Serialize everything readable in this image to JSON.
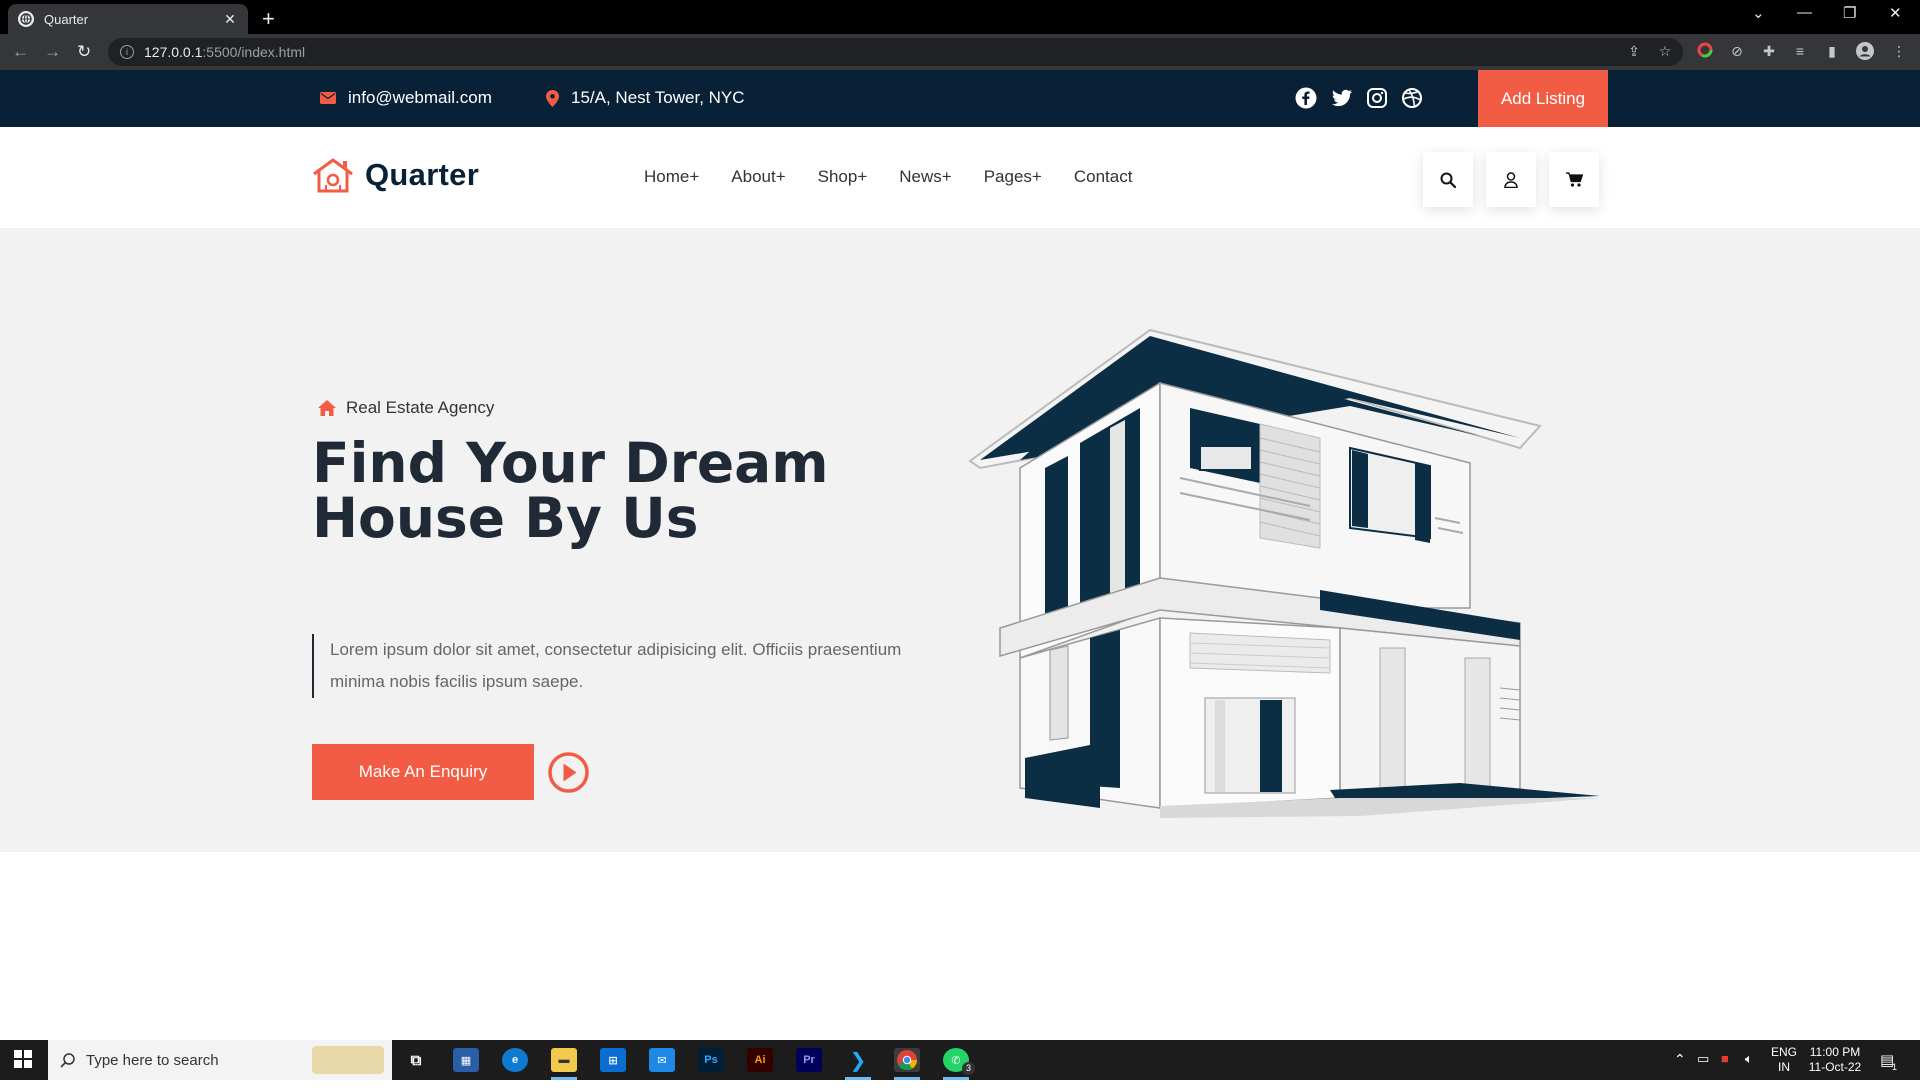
{
  "browser": {
    "tab_title": "Quarter",
    "new_tab": "+",
    "url_host": "127.0.0.1",
    "url_path": ":5500/index.html"
  },
  "topbar": {
    "email": "info@webmail.com",
    "address": "15/A, Nest Tower, NYC",
    "add_listing": "Add Listing"
  },
  "header": {
    "logo_text": "Quarter",
    "nav": [
      "Home+",
      "About+",
      "Shop+",
      "News+",
      "Pages+",
      "Contact"
    ]
  },
  "hero": {
    "tagline": "Real Estate Agency",
    "headline_line1": "Find Your Dream",
    "headline_line2": "House By Us",
    "description": "Lorem ipsum dolor sit amet, consectetur adipisicing elit. Officiis praesentium minima nobis facilis ipsum saepe.",
    "cta": "Make An Enquiry"
  },
  "taskbar": {
    "search_placeholder": "Type here to search",
    "lang": "ENG",
    "region": "IN",
    "time": "11:00 PM",
    "date": "11-Oct-22",
    "whatsapp_badge": "3",
    "notification_badge": "1"
  },
  "colors": {
    "accent": "#f25c45",
    "navy": "#082137",
    "hero_bg": "#f2f2f2"
  }
}
